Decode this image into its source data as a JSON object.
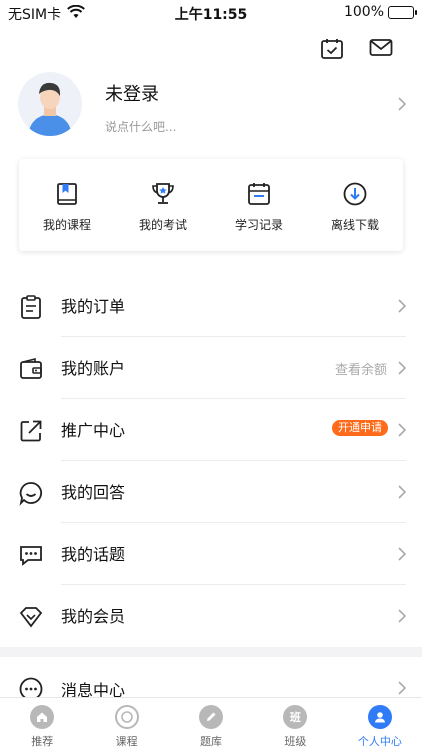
{
  "status_bar": {
    "carrier": "无SIM卡",
    "time": "上午11:55",
    "battery_percent": "100%",
    "battery_level": 1.0,
    "battery_color": "#3ec93e"
  },
  "header": {
    "calendar_icon": "calendar-check-icon",
    "mail_icon": "mail-icon"
  },
  "profile": {
    "name": "未登录",
    "subtitle": "说点什么吧..."
  },
  "quick_actions": [
    {
      "label": "我的课程",
      "icon": "book-icon"
    },
    {
      "label": "我的考试",
      "icon": "trophy-icon"
    },
    {
      "label": "学习记录",
      "icon": "calendar-icon"
    },
    {
      "label": "离线下载",
      "icon": "download-icon"
    }
  ],
  "menu": [
    {
      "label": "我的订单",
      "icon": "clipboard-icon",
      "hint": "",
      "badge": ""
    },
    {
      "label": "我的账户",
      "icon": "wallet-icon",
      "hint": "查看余额",
      "badge": ""
    },
    {
      "label": "推广中心",
      "icon": "share-external-icon",
      "hint": "",
      "badge": "开通申请"
    },
    {
      "label": "我的回答",
      "icon": "chat-bubble-icon",
      "hint": "",
      "badge": ""
    },
    {
      "label": "我的话题",
      "icon": "comment-icon",
      "hint": "",
      "badge": ""
    },
    {
      "label": "我的会员",
      "icon": "diamond-icon",
      "hint": "",
      "badge": ""
    }
  ],
  "message_center": {
    "label": "消息中心",
    "icon": "more-circle-icon"
  },
  "tabbar": [
    {
      "label": "推荐",
      "glyph": "",
      "icon": "home-icon",
      "active": false
    },
    {
      "label": "课程",
      "glyph": "",
      "icon": "target-icon",
      "active": false
    },
    {
      "label": "题库",
      "glyph": "",
      "icon": "pencil-icon",
      "active": false
    },
    {
      "label": "班级",
      "glyph": "班",
      "icon": "class-icon",
      "active": false
    },
    {
      "label": "个人中心",
      "glyph": "",
      "icon": "person-icon",
      "active": true
    }
  ],
  "colors": {
    "accent": "#2f7cf6",
    "badge": "#ff6a1a"
  }
}
